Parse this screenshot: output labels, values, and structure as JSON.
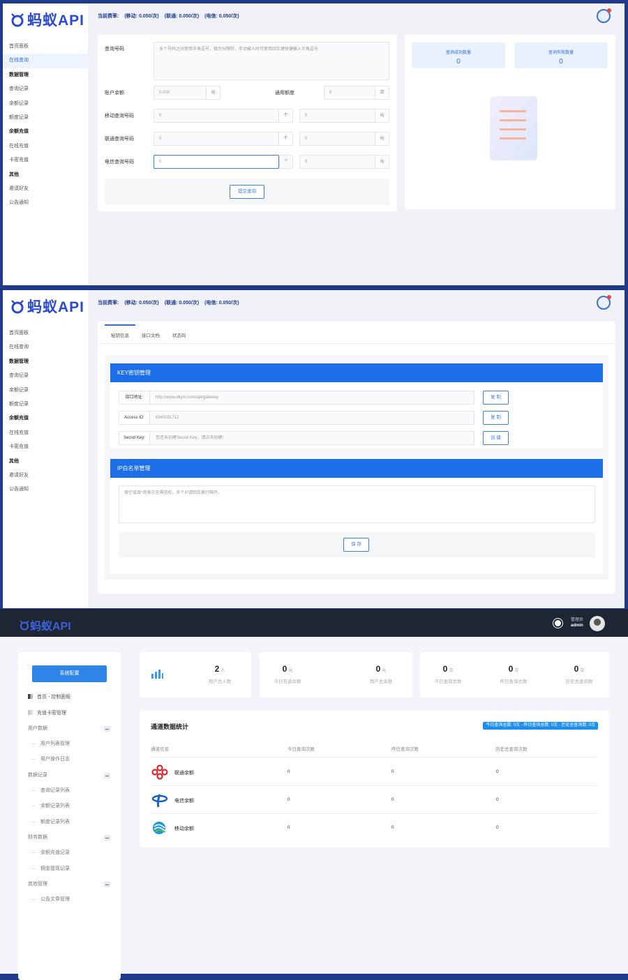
{
  "brand": {
    "name": "蚂蚁API"
  },
  "rate": {
    "label": "当前费率:",
    "mobile": "(移动: 0.050/次)",
    "unicom": "(联通: 0.050/次)",
    "telecom": "(电信: 0.050/次)"
  },
  "sidebar": [
    {
      "label": "首页面板"
    },
    {
      "label": "在线查询"
    },
    {
      "label": "数据管理"
    },
    {
      "label": "查询记录"
    },
    {
      "label": "余额记录"
    },
    {
      "label": "额度记录"
    },
    {
      "label": "余额充值"
    },
    {
      "label": "在线充值"
    },
    {
      "label": "卡密充值"
    },
    {
      "label": "其他"
    },
    {
      "label": "邀请好友"
    },
    {
      "label": "公告通知"
    }
  ],
  "query": {
    "phone_label": "查询号码",
    "phone_placeholder": "多个号码之间使用半角逗号，做为分隔符，手动输入时可使用回车键快捷输入半角逗号",
    "balance_label": "账户余额",
    "balance_value": "0.000",
    "yuan": "元",
    "general_label": "通用额度",
    "general_value": "0",
    "times": "次",
    "mobile_label": "移动查询号码",
    "unicom_label": "联通查询号码",
    "telecom_label": "电信查询号码",
    "zero": "0",
    "arrow": "个",
    "submit": "提交查询"
  },
  "stats_panel": {
    "success_label": "查询成功数量",
    "success_value": "0",
    "fail_label": "查询失败数量",
    "fail_value": "0"
  },
  "api": {
    "tabs": [
      "秘钥信息",
      "接口文档",
      "状态码"
    ],
    "key_section": "KEY密钥管理",
    "url_key": "接口地址:",
    "url_value": "http://www.dkym.com/api/gateway",
    "id_key": "Access ID:",
    "id_value": "6540091712",
    "secret_key": "Secret Key:",
    "secret_value": "您还未创建Secret Key，请点击创建!",
    "copy": "复 制",
    "create": "创 建",
    "ip_section": "IP白名单管理",
    "ip_placeholder": "留空或填*则表示无需授权，多个IP请回车换行隔开。",
    "save": "保 存"
  },
  "admin": {
    "role": "管理员",
    "user": "admin",
    "config_button": "系统配置",
    "menu": {
      "home": "首页 - 控制面板",
      "card": "充值卡密管理",
      "g_user": "用户数据",
      "user_list": "用户列表管理",
      "user_log": "用户操作日志",
      "g_data": "数据记录",
      "query_list": "查询记录列表",
      "balance_list": "余额记录列表",
      "quota_list": "额度记录列表",
      "g_finance": "财务数据",
      "recharge": "余额充值记录",
      "withdraw": "佣金提现记录",
      "g_other": "其他管理",
      "article": "公告文章管理"
    },
    "cards": {
      "users_value": "2",
      "users_unit": "人",
      "users_label": "用户总人数",
      "today_recharge_value": "0",
      "today_recharge_unit": "元",
      "today_recharge_label": "今日充值余额",
      "total_balance_value": "0",
      "total_balance_unit": "元",
      "total_balance_label": "用户总余额",
      "today_q_value": "0",
      "today_q_unit": "次",
      "today_q_label": "今日查询总数",
      "yest_q_value": "0",
      "yest_q_unit": "次",
      "yest_q_label": "昨日查询总数",
      "hist_q_value": "0",
      "hist_q_unit": "次",
      "hist_q_label": "历史总查询数"
    },
    "table": {
      "title": "通道数据统计",
      "badge": "今日查询总数: 0次 - 昨日查询总数: 0次 - 历史总查询数: 0次",
      "headers": [
        "通道信息",
        "今日查询次数",
        "昨日查询次数",
        "历史总查询次数"
      ],
      "rows": [
        {
          "name": "联通余额",
          "today": "0",
          "yest": "0",
          "total": "0"
        },
        {
          "name": "电信余额",
          "today": "0",
          "yest": "0",
          "total": "0"
        },
        {
          "name": "移动余额",
          "today": "0",
          "yest": "0",
          "total": "0"
        }
      ]
    }
  },
  "colors": {
    "accent": "#2f6fe0",
    "header_blue": "#1c6fe8",
    "dark_bar": "#1e2533"
  }
}
